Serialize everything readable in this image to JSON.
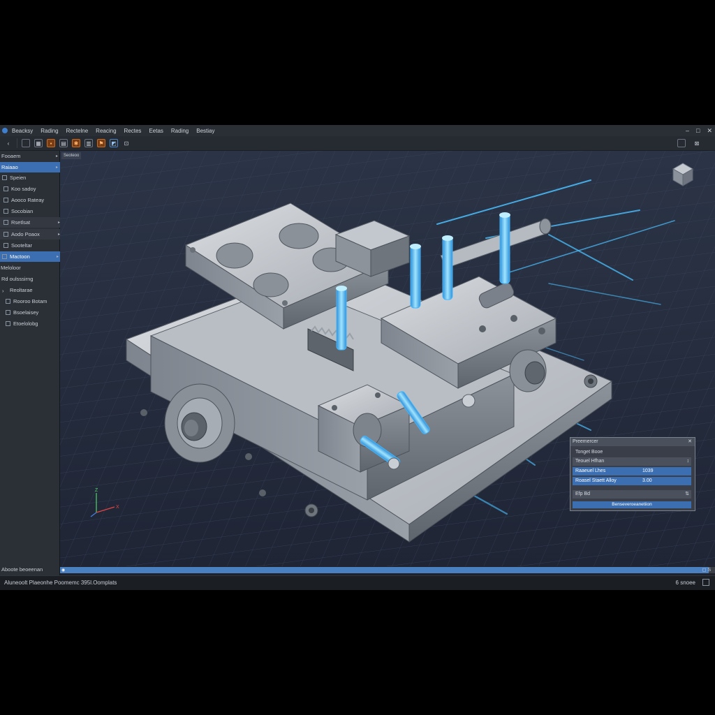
{
  "menu": [
    "Beacksy",
    "Rading",
    "Rectelne",
    "Reacing",
    "Rectes",
    "Eetas",
    "Rading",
    "Bestiay"
  ],
  "window_controls": [
    "–",
    "□",
    "✕"
  ],
  "toolbar": {
    "buttons": [
      "arrow-left-icon",
      "select-icon",
      "grid-icon",
      "extrude-icon",
      "measure-icon",
      "snap-icon",
      "view-icon",
      "flag-icon",
      "render-icon",
      "fit-icon"
    ]
  },
  "sidebar": {
    "items": [
      {
        "label": "Fooaem",
        "selected": false,
        "arrow": true,
        "icon": false
      },
      {
        "label": "Raiaao",
        "selected": true,
        "arrow": true,
        "icon": false
      },
      {
        "label": "Speien",
        "selected": false,
        "arrow": false,
        "icon": true
      },
      {
        "label": "Koo sadoy",
        "selected": false,
        "arrow": false,
        "icon": true
      },
      {
        "label": "Aooco Rateay",
        "selected": false,
        "arrow": false,
        "icon": true
      },
      {
        "label": "Socobian",
        "selected": false,
        "arrow": false,
        "icon": true
      },
      {
        "label": "Rsetlsat",
        "selected": false,
        "arrow": true,
        "icon": true
      },
      {
        "label": "Aodo Poaox",
        "selected": false,
        "arrow": true,
        "icon": true
      },
      {
        "label": "Sooteltar",
        "selected": false,
        "arrow": false,
        "icon": true
      },
      {
        "label": "Mactoon",
        "selected": true,
        "arrow": true,
        "icon": true
      },
      {
        "label": "Meloloor",
        "selected": false,
        "arrow": false,
        "icon": false
      },
      {
        "label": "Rd oulsssirng",
        "selected": false,
        "arrow": false,
        "icon": false
      },
      {
        "label": "Reoltarae",
        "selected": false,
        "arrow": false,
        "icon": true
      },
      {
        "label": "Rooroo Botam",
        "selected": false,
        "arrow": false,
        "icon": true
      },
      {
        "label": "Bsoelaisey",
        "selected": false,
        "arrow": false,
        "icon": true
      },
      {
        "label": "Etoelolobg",
        "selected": false,
        "arrow": false,
        "icon": true
      }
    ],
    "status": "Aboote beoeenan"
  },
  "viewport": {
    "tab": "Seoteoo",
    "axis": {
      "x": "X",
      "y": "Y",
      "z": "Z"
    }
  },
  "properties": {
    "title": "Preemercer",
    "rows": [
      {
        "label": "Tonget Booe",
        "value": "",
        "selected": false,
        "end": ""
      },
      {
        "label": "Teouel Hfhan",
        "value": "",
        "selected": false,
        "end": "↕"
      },
      {
        "label": "Raaeuel Lhes",
        "value": "1039",
        "selected": true,
        "end": ""
      },
      {
        "label": "Roasel   Staett Alloy",
        "value": "3.00",
        "selected": true,
        "end": ""
      },
      {
        "label": "Efp Bd",
        "value": "",
        "selected": false,
        "end": "⇅"
      }
    ],
    "apply_label": "Benseveroeanetiion"
  },
  "progress": {
    "value": 0.99,
    "right_text": "◻ S"
  },
  "status": {
    "left": "Aluneoolt Plaeonhe Poomemc 395l.Oomplats",
    "right": "6 snoee"
  }
}
